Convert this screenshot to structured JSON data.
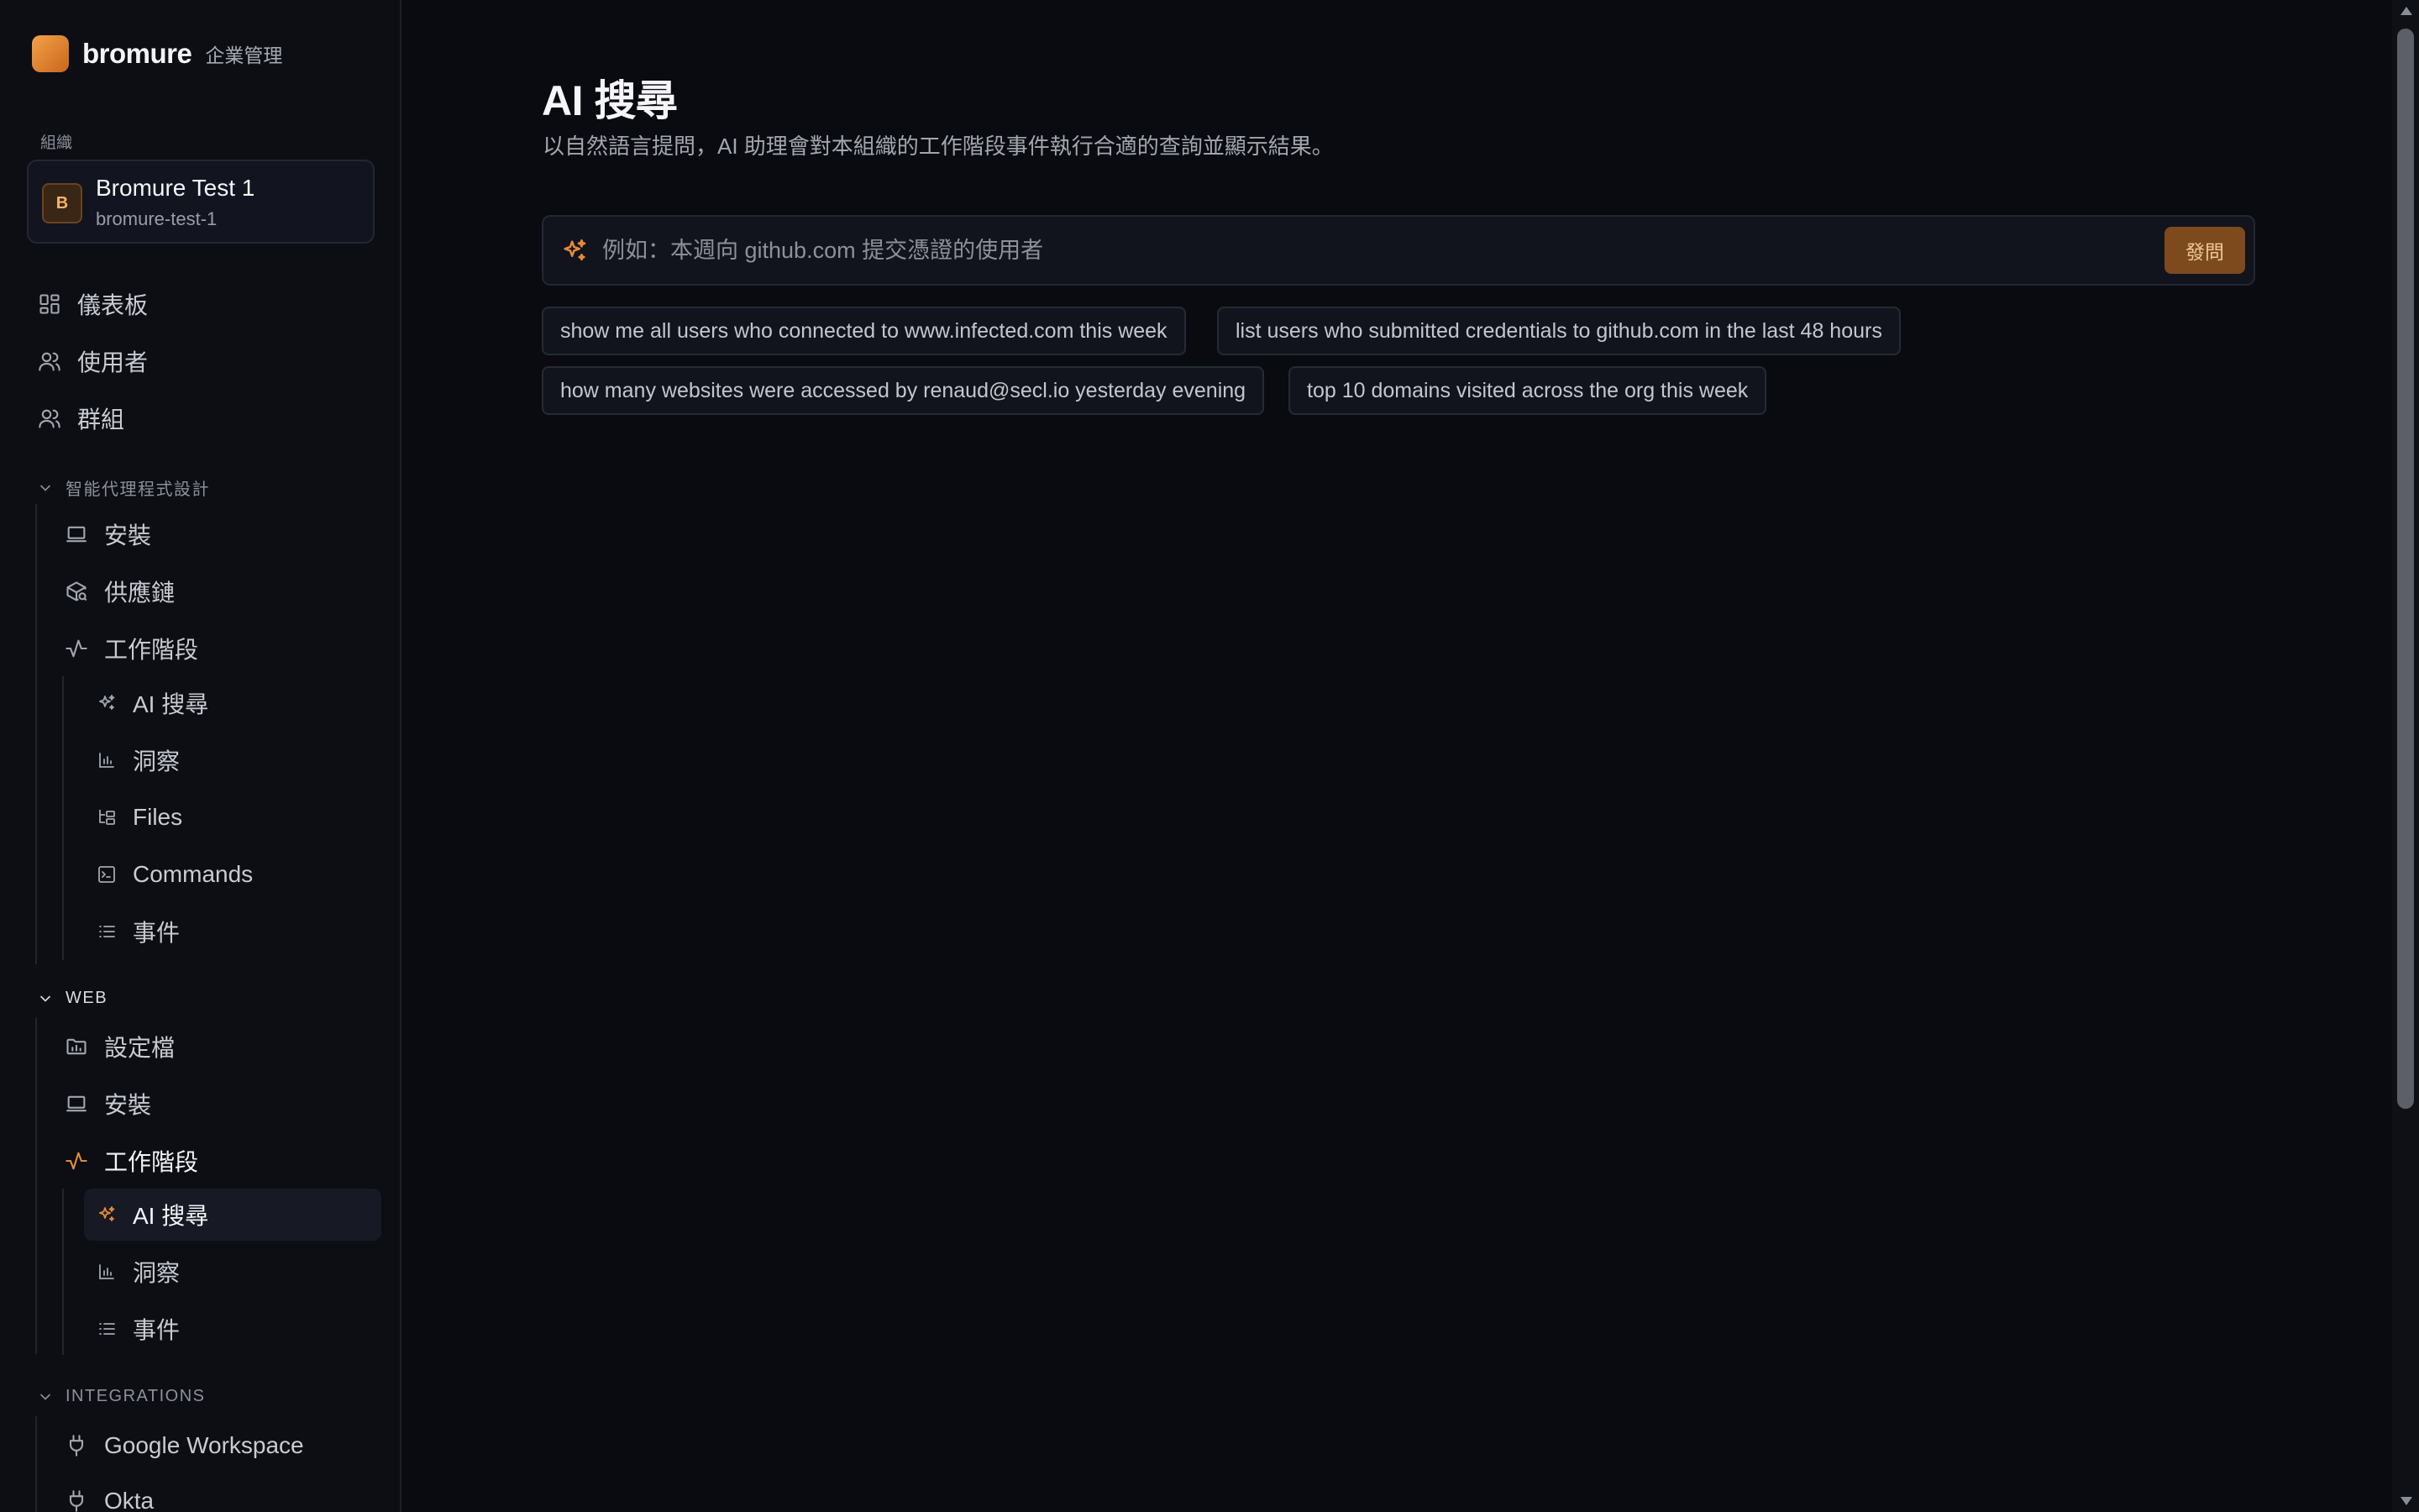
{
  "brand": {
    "name": "bromure",
    "subtitle": "企業管理"
  },
  "org": {
    "caption": "組織",
    "avatar": "B",
    "name": "Bromure Test 1",
    "slug": "bromure-test-1"
  },
  "nav": {
    "top": [
      {
        "label": "儀表板",
        "icon": "dashboard-icon"
      },
      {
        "label": "使用者",
        "icon": "user-icon"
      },
      {
        "label": "群組",
        "icon": "users-icon"
      }
    ],
    "agent_section": {
      "title": "智能代理程式設計",
      "items": [
        {
          "label": "安裝",
          "icon": "laptop-icon"
        },
        {
          "label": "供應鏈",
          "icon": "package-search-icon"
        },
        {
          "label": "工作階段",
          "icon": "activity-icon"
        }
      ],
      "sessions": [
        {
          "label": "AI 搜尋",
          "icon": "sparkles-icon"
        },
        {
          "label": "洞察",
          "icon": "bar-chart-icon"
        },
        {
          "label": "Files",
          "icon": "folder-tree-icon"
        },
        {
          "label": "Commands",
          "icon": "terminal-icon"
        },
        {
          "label": "事件",
          "icon": "list-icon"
        }
      ]
    },
    "web_section": {
      "title": "WEB",
      "items": [
        {
          "label": "設定檔",
          "icon": "folder-chart-icon"
        },
        {
          "label": "安裝",
          "icon": "laptop-icon"
        },
        {
          "label": "工作階段",
          "icon": "activity-icon"
        }
      ],
      "sessions": [
        {
          "label": "AI 搜尋",
          "icon": "sparkles-icon",
          "active": true
        },
        {
          "label": "洞察",
          "icon": "bar-chart-icon"
        },
        {
          "label": "事件",
          "icon": "list-icon"
        }
      ]
    },
    "integrations_section": {
      "title": "INTEGRATIONS",
      "items": [
        {
          "label": "Google Workspace",
          "icon": "plug-icon"
        },
        {
          "label": "Okta",
          "icon": "plug-icon"
        }
      ]
    }
  },
  "main": {
    "title": "AI 搜尋",
    "description": "以自然語言提問，AI 助理會對本組織的工作階段事件執行合適的查詢並顯示結果。",
    "search": {
      "placeholder": "例如：本週向 github.com 提交憑證的使用者",
      "value": "",
      "button": "發問"
    },
    "suggestions": [
      "show me all users who connected to www.infected.com this week",
      "list users who submitted credentials to github.com in the last 48 hours",
      "how many websites were accessed by renaud@secl.io yesterday evening",
      "top 10 domains visited across the org this week"
    ]
  },
  "colors": {
    "accent": "#e48a3a",
    "background": "#090b11",
    "sidebar": "#0c0e14"
  }
}
